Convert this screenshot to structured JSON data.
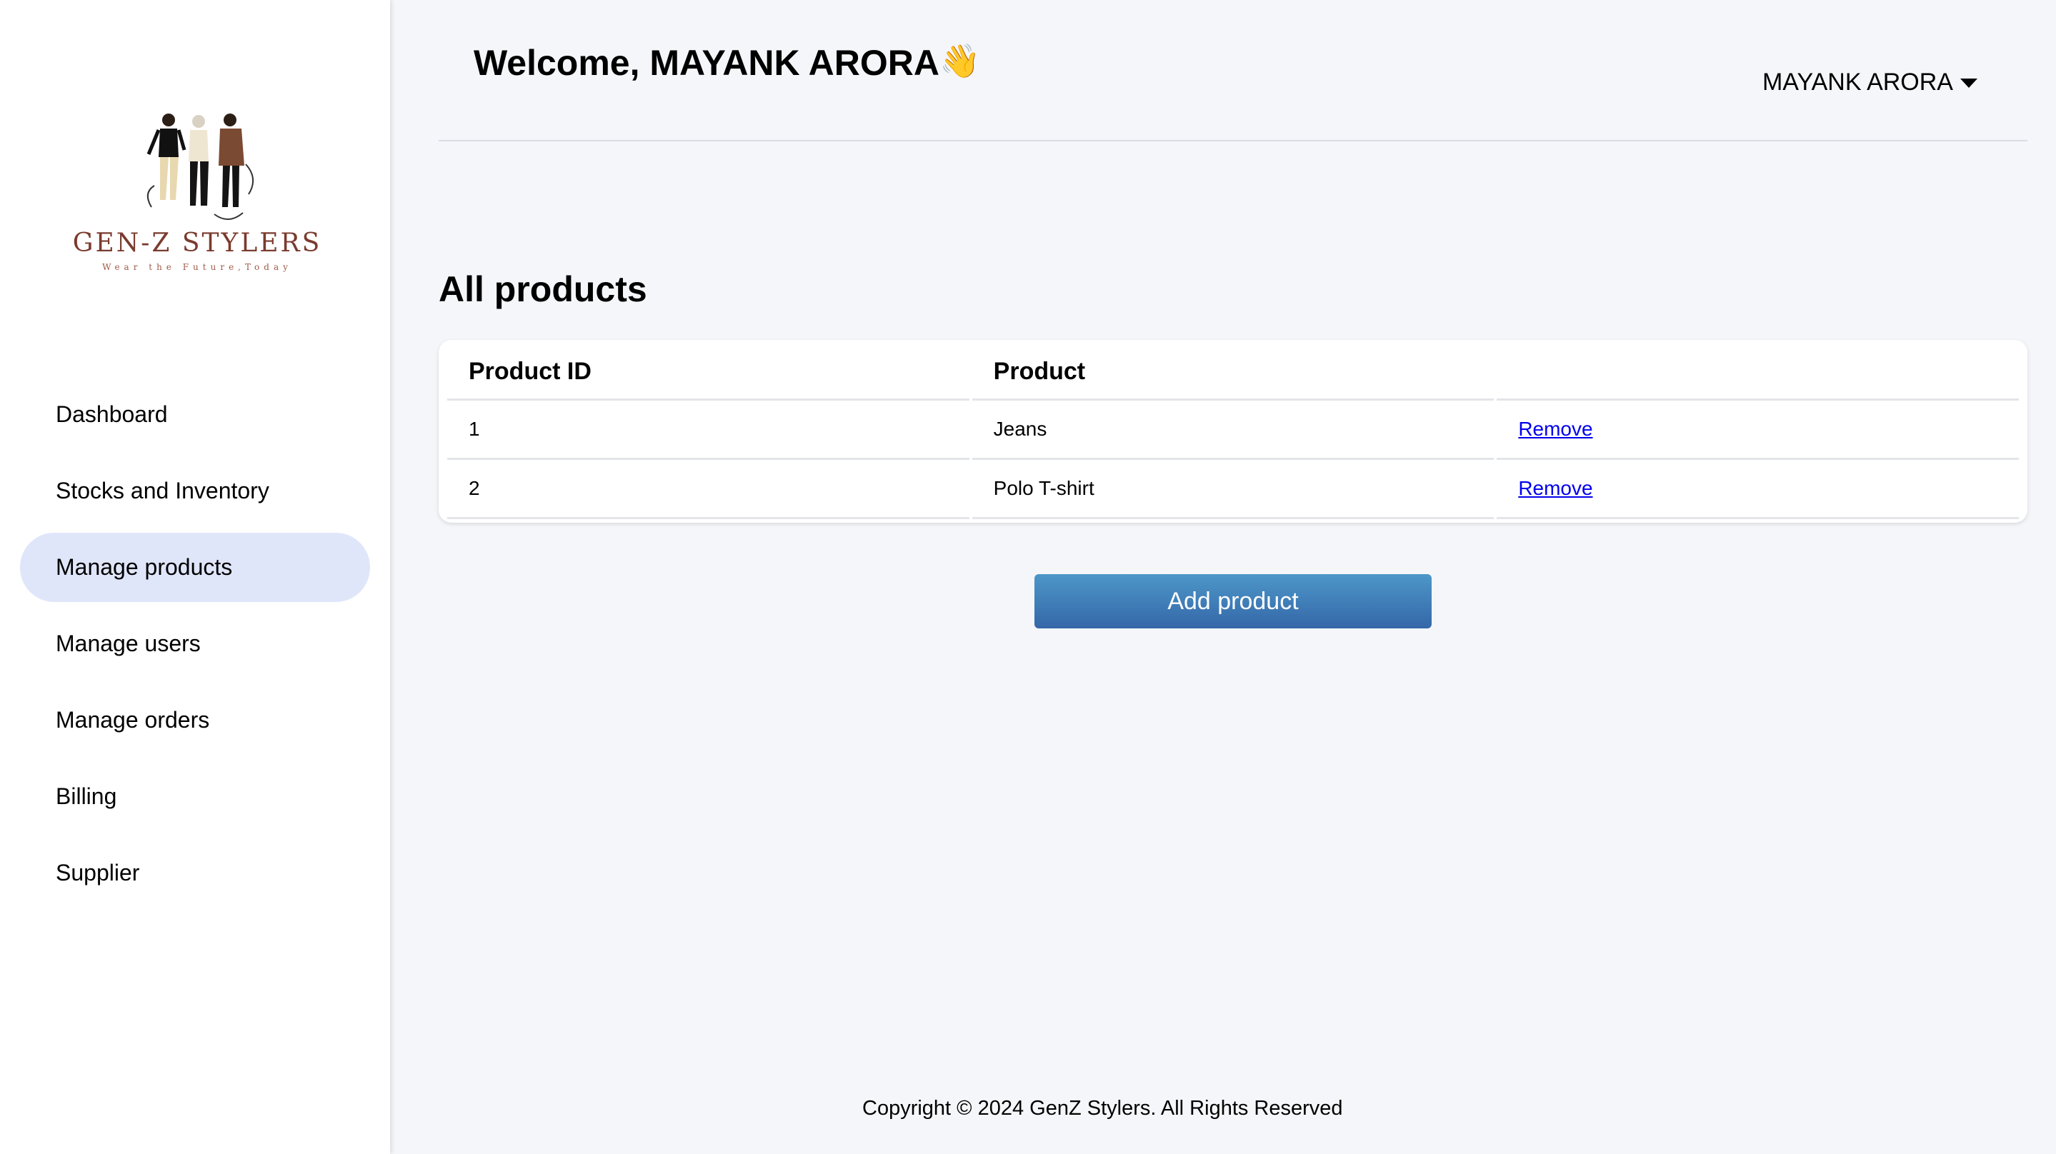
{
  "sidebar": {
    "logo": {
      "brand": "GEN-Z STYLERS",
      "tagline": "Wear the Future, Today"
    },
    "items": [
      {
        "label": "Dashboard",
        "active": false
      },
      {
        "label": "Stocks and Inventory",
        "active": false
      },
      {
        "label": "Manage products",
        "active": true
      },
      {
        "label": "Manage users",
        "active": false
      },
      {
        "label": "Manage orders",
        "active": false
      },
      {
        "label": "Billing",
        "active": false
      },
      {
        "label": "Supplier",
        "active": false
      }
    ]
  },
  "header": {
    "welcome": "Welcome, MAYANK ARORA",
    "wave_emoji": "👋",
    "user_menu_label": "MAYANK ARORA"
  },
  "main": {
    "title": "All products",
    "table": {
      "columns": [
        "Product ID",
        "Product",
        ""
      ],
      "rows": [
        {
          "id": "1",
          "product": "Jeans",
          "action": "Remove"
        },
        {
          "id": "2",
          "product": "Polo T-shirt",
          "action": "Remove"
        }
      ]
    },
    "add_button": "Add product"
  },
  "footer": {
    "copyright": "Copyright © 2024 GenZ Stylers. All Rights Reserved"
  },
  "colors": {
    "page_background": "#f5f6fa",
    "active_nav": "#e0e6fa",
    "button_top": "#4d97c9",
    "button_bottom": "#3467a8",
    "link": "#0000ee",
    "brand": "#7a3b2e"
  }
}
